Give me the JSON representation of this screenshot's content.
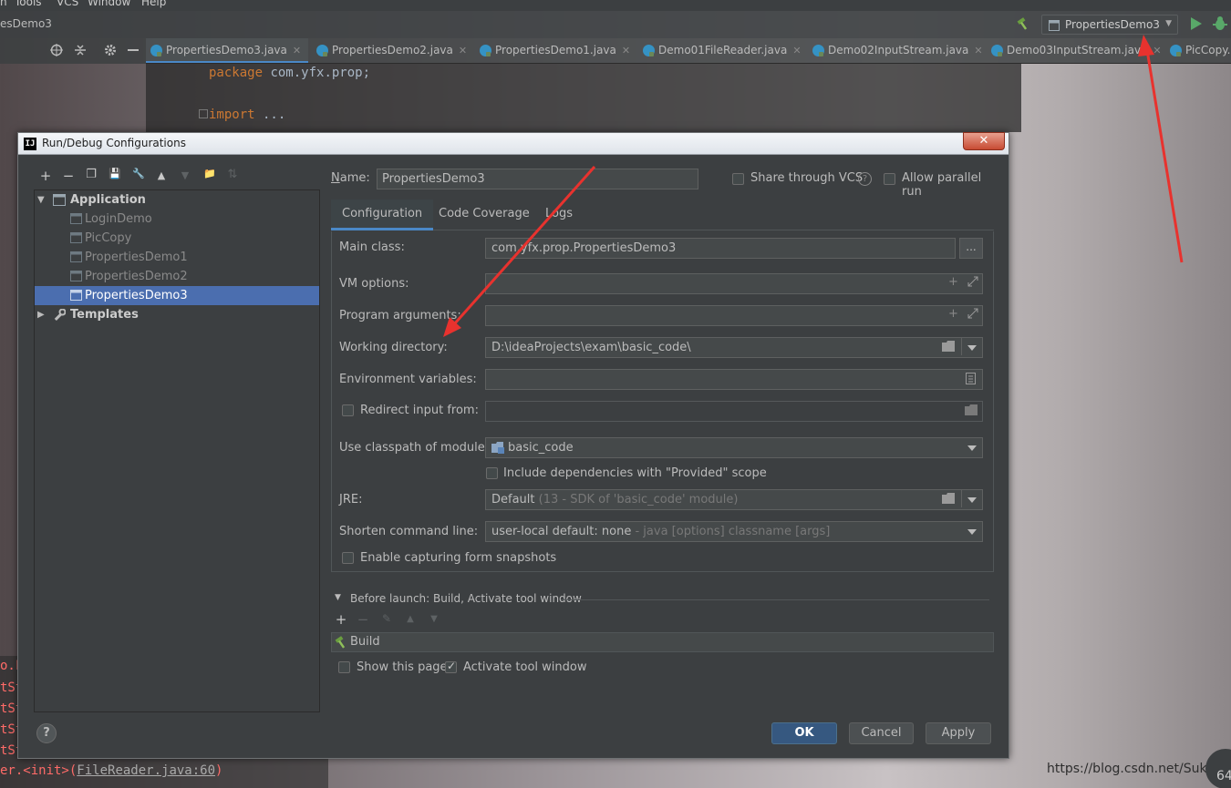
{
  "ide": {
    "menu": [
      "n",
      "Tools",
      "VCS",
      "Window",
      "Help"
    ],
    "project_crumb": "esDemo3",
    "run_config_selected": "PropertiesDemo3",
    "editor_tabs": [
      {
        "label": "PropertiesDemo3.java",
        "active": true
      },
      {
        "label": "PropertiesDemo2.java",
        "active": false
      },
      {
        "label": "PropertiesDemo1.java",
        "active": false
      },
      {
        "label": "Demo01FileReader.java",
        "active": false
      },
      {
        "label": "Demo02InputStream.java",
        "active": false
      },
      {
        "label": "Demo03InputStream.java",
        "active": false
      },
      {
        "label": "PicCopy.",
        "active": false
      }
    ],
    "code_lines": [
      {
        "kw": "package",
        "rest": " com.yfx.prop;"
      },
      {
        "kw": "import",
        "rest": " ..."
      }
    ],
    "console_fragments": [
      "o.F",
      "tSt",
      "tSt",
      "tSt",
      "tSt"
    ],
    "console_bottom": {
      "prefix": "er.<init>(",
      "link": "FileReader.java:60",
      "suffix": ")"
    },
    "watermark": "https://blog.csdn.net/Suk",
    "watermark_badge": "64"
  },
  "dialog": {
    "title": "Run/Debug Configurations",
    "close_glyph": "✕",
    "app_icon_text": "IJ",
    "tree": {
      "toolbar_glyphs": [
        "+",
        "−",
        "❐",
        "💾",
        "🔧",
        "▲",
        "▼",
        "📁",
        "⇅"
      ],
      "nodes": [
        {
          "label": "Application",
          "level": 0,
          "bold": true,
          "expanded": true,
          "selected": false
        },
        {
          "label": "LoginDemo",
          "level": 1,
          "bold": false,
          "selected": false
        },
        {
          "label": "PicCopy",
          "level": 1,
          "bold": false,
          "selected": false
        },
        {
          "label": "PropertiesDemo1",
          "level": 1,
          "bold": false,
          "selected": false
        },
        {
          "label": "PropertiesDemo2",
          "level": 1,
          "bold": false,
          "selected": false
        },
        {
          "label": "PropertiesDemo3",
          "level": 1,
          "bold": false,
          "selected": true
        },
        {
          "label": "Templates",
          "level": 0,
          "bold": true,
          "expanded": false,
          "selected": false
        }
      ]
    },
    "name_label": "Name:",
    "name_value": "PropertiesDemo3",
    "share_vcs": {
      "label": "Share through VCS",
      "checked": false
    },
    "help_glyph": "?",
    "allow_parallel": {
      "label": "Allow parallel run",
      "checked": false
    },
    "tabs": [
      {
        "label": "Configuration",
        "active": true
      },
      {
        "label": "Code Coverage",
        "active": false
      },
      {
        "label": "Logs",
        "active": false
      }
    ],
    "fields": {
      "main_class": {
        "label": "Main class:",
        "value": "com.yfx.prop.PropertiesDemo3",
        "browse": "..."
      },
      "vm_options": {
        "label": "VM options:",
        "value": ""
      },
      "program_args": {
        "label": "Program arguments:",
        "value": ""
      },
      "working_dir": {
        "label": "Working directory:",
        "value": "D:\\ideaProjects\\exam\\basic_code\\"
      },
      "env_vars": {
        "label": "Environment variables:",
        "value": ""
      },
      "redirect_input": {
        "label": "Redirect input from:",
        "value": "",
        "checked": false
      },
      "classpath_module": {
        "label": "Use classpath of module:",
        "value": "basic_code"
      },
      "include_provided": {
        "label": "Include dependencies with \"Provided\" scope",
        "checked": false
      },
      "jre": {
        "label": "JRE:",
        "value": "Default",
        "hint": "(13 - SDK of 'basic_code' module)"
      },
      "shorten_cmd": {
        "label": "Shorten command line:",
        "value": "user-local default: none",
        "hint": "- java [options] classname [args]"
      },
      "capture_snapshots": {
        "label": "Enable capturing form snapshots",
        "checked": false
      }
    },
    "before_launch": {
      "header": "Before launch: Build, Activate tool window",
      "toolbar_glyphs": [
        "+",
        "−",
        "✎",
        "▲",
        "▼"
      ],
      "items": [
        "Build"
      ]
    },
    "show_page": {
      "label": "Show this page",
      "checked": false
    },
    "activate_tool": {
      "label": "Activate tool window",
      "checked": true
    },
    "buttons": {
      "ok": "OK",
      "cancel": "Cancel",
      "apply": "Apply"
    }
  },
  "colors": {
    "accent": "#4a88c7",
    "selection": "#4b6eaf",
    "primary_button": "#365880",
    "annotation_arrow": "#e8322e",
    "keyword": "#cc7832",
    "error_text": "#ff6b68"
  }
}
